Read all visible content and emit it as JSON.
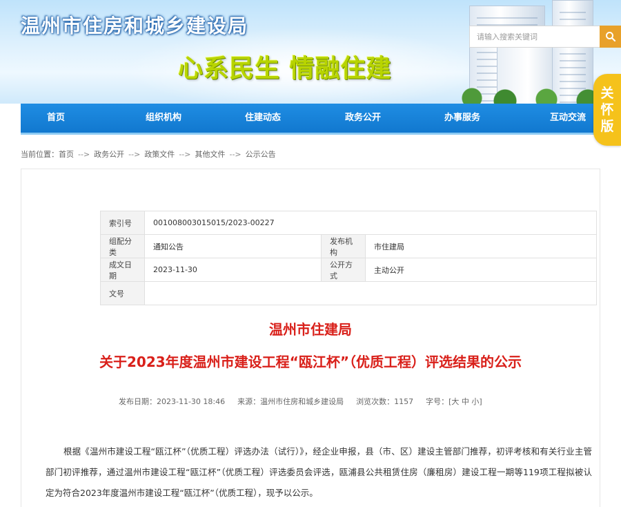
{
  "header": {
    "site_title": "温州市住房和城乡建设局",
    "slogan": "心系民生  情融住建",
    "search_placeholder": "请输入搜索关键词",
    "care_badge": [
      "关",
      "怀",
      "版"
    ]
  },
  "nav": {
    "items": [
      "首页",
      "组织机构",
      "住建动态",
      "政务公开",
      "办事服务",
      "互动交流"
    ]
  },
  "breadcrumb": {
    "prefix": "当前位置：",
    "items": [
      "首页",
      "政务公开",
      "政策文件",
      "其他文件",
      "公示公告"
    ],
    "separator": "-->"
  },
  "info": {
    "index_label": "索引号",
    "index_value": "001008003015015/2023-00227",
    "category_label": "组配分类",
    "category_value": "通知公告",
    "publisher_label": "发布机构",
    "publisher_value": "市住建局",
    "date_label": "成文日期",
    "date_value": "2023-11-30",
    "disclosure_label": "公开方式",
    "disclosure_value": "主动公开",
    "docno_label": "文号",
    "docno_value": ""
  },
  "article": {
    "org": "温州市住建局",
    "title": "关于2023年度温州市建设工程“瓯江杯”（优质工程）评选结果的公示",
    "publish_label": "发布日期：",
    "publish_date": "2023-11-30 18:46",
    "source_label": "来源：",
    "source": "温州市住房和城乡建设局",
    "views_label": "浏览次数：",
    "views": "1157",
    "fontsize_label": "字号：",
    "fontsize_options": "[大 中 小]",
    "body": "根据《温州市建设工程“瓯江杯”（优质工程）评选办法（试行）》，经企业申报，县（市、区）建设主管部门推荐，初评考核和有关行业主管部门初评推荐，通过温州市建设工程“瓯江杯”（优质工程）评选委员会评选，瓯浦县公共租赁住房（廉租房）建设工程一期等119项工程拟被认定为符合2023年度温州市建设工程“瓯江杯”（优质工程），现予以公示。"
  },
  "colors": {
    "nav_blue": "#1178cf",
    "title_red": "#d9201a",
    "search_orange": "#e8a12a",
    "badge_yellow": "#f5c21b",
    "slogan_green": "#b8d400"
  }
}
